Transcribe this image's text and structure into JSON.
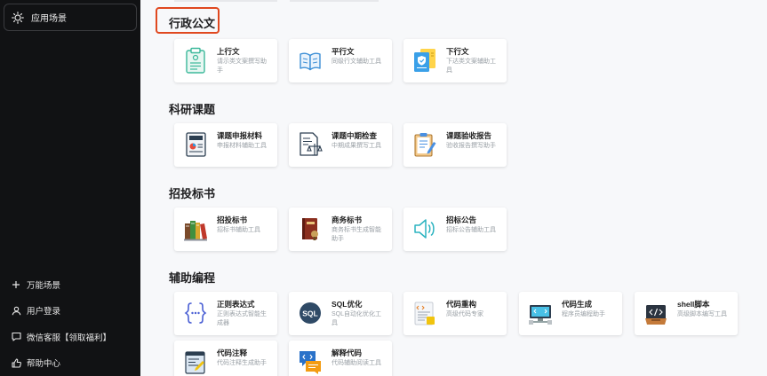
{
  "sidebar": {
    "top_item": {
      "label": "应用场景",
      "icon": "sun-icon"
    },
    "bottom_items": [
      {
        "label": "万能场景",
        "icon": "plus-icon"
      },
      {
        "label": "用户登录",
        "icon": "user-icon"
      },
      {
        "label": "微信客服【领取福利】",
        "icon": "chat-icon"
      },
      {
        "label": "帮助中心",
        "icon": "thumbs-up-icon"
      }
    ]
  },
  "sections": [
    {
      "title": "行政公文",
      "cards": [
        {
          "title": "上行文",
          "desc": "请示类文案撰写助手",
          "icon": "clipboard-icon"
        },
        {
          "title": "平行文",
          "desc": "同级行文辅助工具",
          "icon": "open-book-icon"
        },
        {
          "title": "下行文",
          "desc": "下达类文案辅助工具",
          "icon": "document-shield-icon"
        }
      ]
    },
    {
      "title": "科研课题",
      "cards": [
        {
          "title": "课题申报材料",
          "desc": "申报材料辅助工具",
          "icon": "report-icon"
        },
        {
          "title": "课题中期检查",
          "desc": "中期成果撰写工具",
          "icon": "document-scale-icon"
        },
        {
          "title": "课题验收报告",
          "desc": "验收报告撰写助手",
          "icon": "clipboard-pencil-icon"
        }
      ]
    },
    {
      "title": "招投标书",
      "cards": [
        {
          "title": "招投标书",
          "desc": "招标书辅助工具",
          "icon": "books-icon"
        },
        {
          "title": "商务标书",
          "desc": "商务标书生成智能助手",
          "icon": "book-stamp-icon"
        },
        {
          "title": "招标公告",
          "desc": "招标公告辅助工具",
          "icon": "speaker-icon"
        }
      ]
    },
    {
      "title": "辅助编程",
      "cards": [
        {
          "title": "正则表达式",
          "desc": "正则表达式智能生成器",
          "icon": "braces-icon"
        },
        {
          "title": "SQL优化",
          "desc": "SQL自动化优化工具",
          "icon": "sql-icon"
        },
        {
          "title": "代码重构",
          "desc": "高级代码专家",
          "icon": "code-document-icon"
        },
        {
          "title": "代码生成",
          "desc": "程序员编程助手",
          "icon": "computer-icon"
        },
        {
          "title": "shell脚本",
          "desc": "高级脚本编写工具",
          "icon": "code-box-icon"
        },
        {
          "title": "代码注释",
          "desc": "代码注释生成助手",
          "icon": "code-editor-icon"
        },
        {
          "title": "解释代码",
          "desc": "代码辅助阅读工具",
          "icon": "code-chat-icon"
        }
      ]
    }
  ]
}
